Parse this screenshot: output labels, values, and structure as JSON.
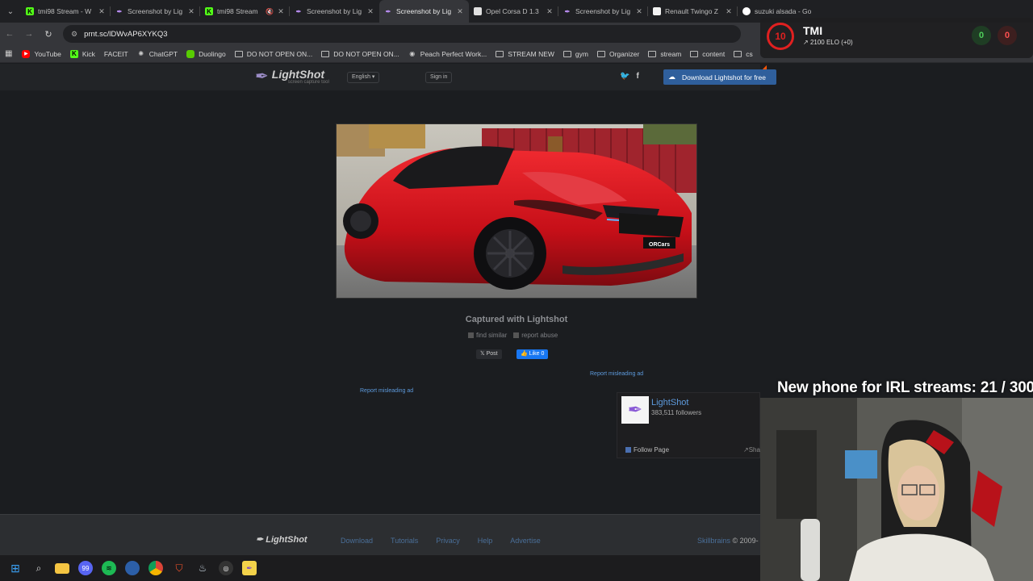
{
  "browser": {
    "tabs": [
      {
        "title": "tmi98 Stream - W",
        "icon": "kick-icon",
        "active": false
      },
      {
        "title": "Screenshot by Lig",
        "icon": "feather-icon",
        "active": false
      },
      {
        "title": "tmi98 Stream",
        "icon": "kick-icon",
        "active": false,
        "muted": true
      },
      {
        "title": "Screenshot by Lig",
        "icon": "feather-icon",
        "active": false
      },
      {
        "title": "Screenshot by Lig",
        "icon": "feather-icon",
        "active": true
      },
      {
        "title": "Opel Corsa D 1.3",
        "icon": "opel-icon",
        "active": false
      },
      {
        "title": "Screenshot by Lig",
        "icon": "feather-icon",
        "active": false
      },
      {
        "title": "Renault Twingo Z",
        "icon": "renault-icon",
        "active": false
      },
      {
        "title": "suzuki alsada - Go",
        "icon": "google-icon",
        "active": false
      }
    ],
    "url": "prnt.sc/lDWvAP6XYKQ3",
    "bookmarks": [
      {
        "label": "YouTube",
        "icon": "youtube-icon"
      },
      {
        "label": "Kick",
        "icon": "kick-icon"
      },
      {
        "label": "FACEIT",
        "icon": "faceit-icon"
      },
      {
        "label": "ChatGPT",
        "icon": "chatgpt-icon"
      },
      {
        "label": "Duolingo",
        "icon": "duolingo-icon"
      },
      {
        "label": "DO NOT OPEN ON...",
        "icon": "folder-icon"
      },
      {
        "label": "DO NOT OPEN ON...",
        "icon": "folder-icon"
      },
      {
        "label": "Peach Perfect Work...",
        "icon": "peach-icon"
      },
      {
        "label": "STREAM NEW",
        "icon": "folder-icon"
      },
      {
        "label": "gym",
        "icon": "folder-icon"
      },
      {
        "label": "Organizer",
        "icon": "folder-icon"
      },
      {
        "label": "stream",
        "icon": "folder-icon"
      },
      {
        "label": "content",
        "icon": "folder-icon"
      },
      {
        "label": "cs",
        "icon": "folder-icon"
      }
    ]
  },
  "lightshot": {
    "logo_name": "LightShot",
    "logo_tagline": "screen capture tool",
    "language": "English",
    "sign_in": "Sign in",
    "download_label": "Download Lightshot for free",
    "caption": "Captured with Lightshot",
    "find_similar": "find similar",
    "report_abuse": "report abuse",
    "post_label": "Post",
    "like_label": "Like 0",
    "report_ad": "Report misleading ad",
    "fb_page_name": "LightShot",
    "fb_followers": "383,511 followers",
    "fb_follow": "Follow Page",
    "fb_share": "Sha",
    "footer_logo": "LightShot",
    "footer_links": [
      "Download",
      "Tutorials",
      "Privacy",
      "Help",
      "Advertise"
    ],
    "footer_brand": "Skillbrains",
    "footer_copy": "© 2009-"
  },
  "overlay": {
    "faceit_level": "10",
    "faceit_nick": "TMI",
    "faceit_elo": "2100 ELO (+0)",
    "wins": "0",
    "losses": "0",
    "goal_text": "New phone for IRL streams:  21 / 300"
  },
  "taskbar": {
    "discord_badge": "99"
  },
  "colors": {
    "accent_blue": "#2f5f9c",
    "car_red": "#d8101c",
    "faceit_red": "#e02020"
  }
}
